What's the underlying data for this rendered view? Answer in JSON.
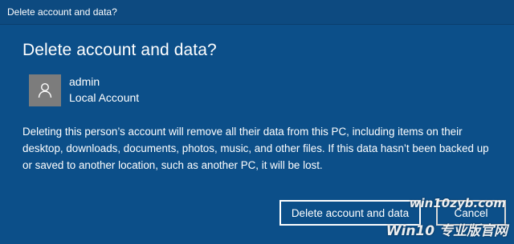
{
  "window": {
    "title": "Delete account and data?"
  },
  "dialog": {
    "heading": "Delete account and data?",
    "account": {
      "name": "admin",
      "type": "Local Account",
      "avatar_icon": "user-icon"
    },
    "message": "Deleting this person’s account will remove all their data from this PC, including items on their desktop, downloads, documents, photos, music, and other files. If this data hasn’t been backed up or saved to another location, such as another PC, it will be lost."
  },
  "buttons": {
    "delete_label": "Delete account and data",
    "cancel_label": "Cancel"
  },
  "watermark": {
    "url": "win10zyb.com",
    "brand": "Win10 专业版官网"
  },
  "colors": {
    "background": "#0c4f89",
    "avatar": "#7c7c7c",
    "text": "#ffffff"
  }
}
